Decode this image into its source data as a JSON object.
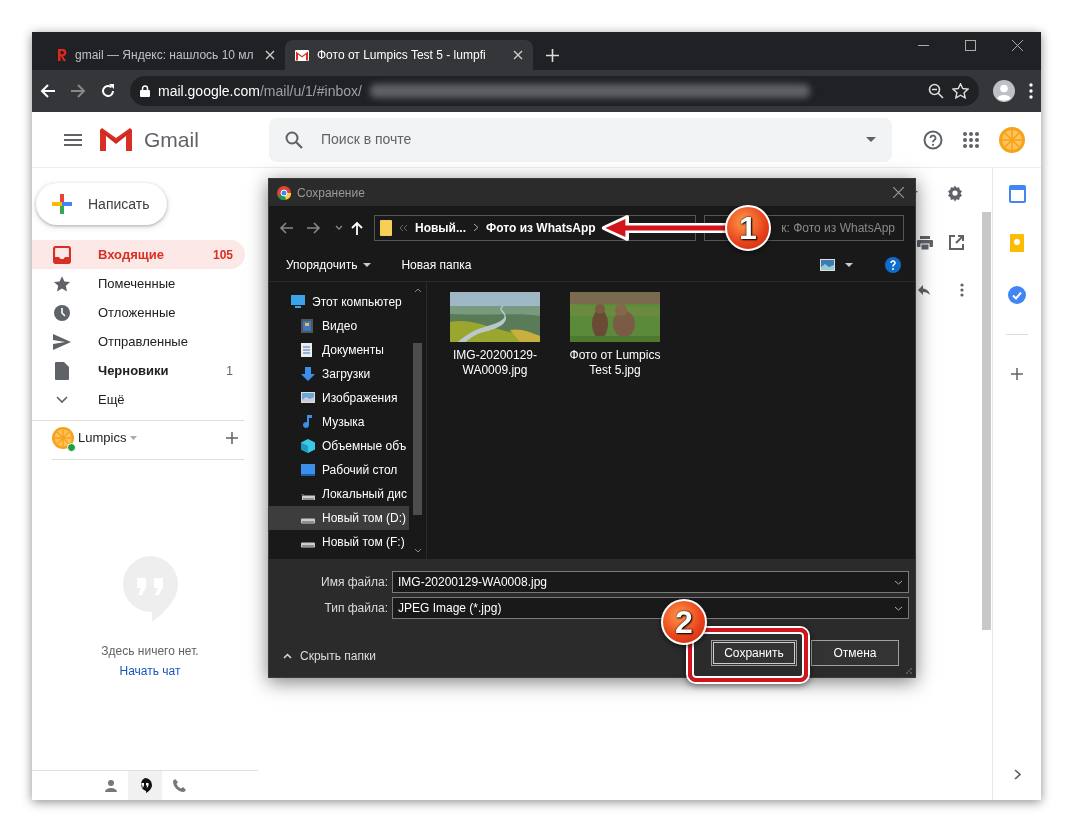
{
  "browser": {
    "tabs": [
      {
        "title": "gmail — Яндекс: нашлось 10 мл",
        "selected": false
      },
      {
        "title": "Фото от Lumpics Test 5 - lumpfi",
        "selected": true
      }
    ],
    "url_host": "mail.google.com",
    "url_path": "/mail/u/1/#inbox/"
  },
  "gmail": {
    "product": "Gmail",
    "search_placeholder": "Поиск в почте",
    "compose": "Написать",
    "nav": [
      {
        "label": "Входящие",
        "count": "105",
        "selected": true,
        "unread": true
      },
      {
        "label": "Помеченные",
        "selected": false,
        "unread": false
      },
      {
        "label": "Отложенные",
        "selected": false,
        "unread": false
      },
      {
        "label": "Отправленные",
        "selected": false,
        "unread": false
      },
      {
        "label": "Черновики",
        "count": "1",
        "selected": false,
        "unread": true
      },
      {
        "label": "Ещё",
        "selected": false,
        "unread": false
      }
    ],
    "account": "Lumpics",
    "chat_empty": "Здесь ничего нет.",
    "chat_link": "Начать чат"
  },
  "dialog": {
    "title": "Сохранение",
    "breadcrumb": [
      "Новый...",
      "Фото из WhatsApp"
    ],
    "search_placeholder": "к: Фото из WhatsApp",
    "toolbar": [
      "Упорядочить",
      "Новая папка"
    ],
    "tree": [
      {
        "label": "Этот компьютер",
        "selected": false,
        "children": [
          {
            "label": "Видео",
            "selected": false
          },
          {
            "label": "Документы",
            "selected": false
          },
          {
            "label": "Загрузки",
            "selected": false
          },
          {
            "label": "Изображения",
            "selected": false
          },
          {
            "label": "Музыка",
            "selected": false
          },
          {
            "label": "Объемные объ",
            "selected": false
          },
          {
            "label": "Рабочий стол",
            "selected": false
          },
          {
            "label": "Локальный дис",
            "selected": false
          },
          {
            "label": "Новый том (D:)",
            "selected": true
          },
          {
            "label": "Новый том (F:)",
            "selected": false
          }
        ]
      }
    ],
    "files": [
      {
        "name": "IMG-20200129-WA0009.jpg",
        "kind": "picture"
      },
      {
        "name": "Фото от Lumpics Test 5.jpg",
        "kind": "picture"
      }
    ],
    "file_name_label": "Имя файла:",
    "file_name": "IMG-20200129-WA0008.jpg",
    "file_type_label": "Тип файла:",
    "file_type": "JPEG Image (*.jpg)",
    "hide_folders": "Скрыть папки",
    "buttons": [
      "Сохранить",
      "Отмена"
    ]
  },
  "annotations": [
    {
      "label": "1"
    },
    {
      "label": "2"
    }
  ]
}
